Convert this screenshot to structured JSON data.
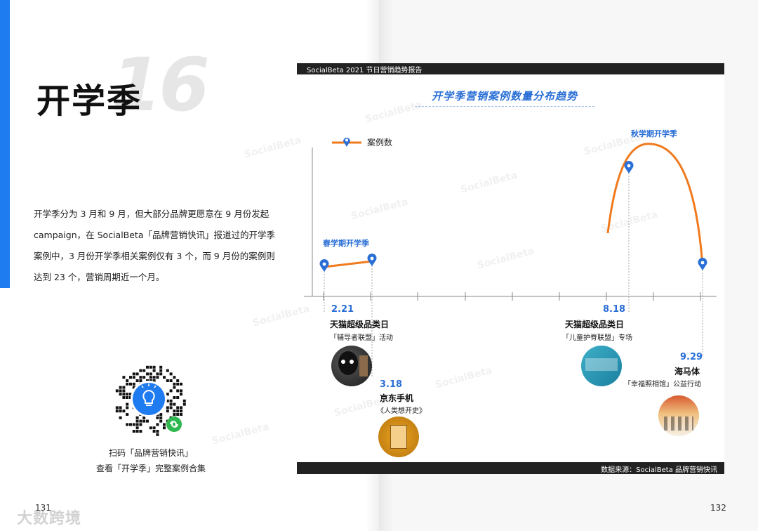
{
  "left_page": {
    "big_number": "16",
    "title": "开学季",
    "paragraph": "开学季分为 3 月和 9 月，但大部分品牌更愿意在 9 月份发起 campaign，在 SocialBeta「品牌营销快讯」报道过的开学季案例中，3 月份开学季相关案例仅有 3 个，而 9 月份的案例则达到 23 个，营销周期近一个月。",
    "qr_caption_line1": "扫码「品牌营销快讯」",
    "qr_caption_line2": "查看「开学季」完整案例合集",
    "page_number": "131",
    "logo_text": "大数跨境"
  },
  "right_page": {
    "page_number": "132",
    "header": "SocialBeta 2021 节日营销趋势报告",
    "footer": "数据来源：SocialBeta 品牌营销快讯",
    "chart_title": "开学季营销案例数量分布趋势",
    "legend_label": "案例数",
    "watermark": "SocialBeta",
    "spring_label": "春学期开学季",
    "autumn_label": "秋学期开学季",
    "events": [
      {
        "date": "2.21",
        "name": "天猫超级品类日",
        "desc": "「辅导者联盟」活动"
      },
      {
        "date": "3.18",
        "name": "京东手机",
        "desc": "《人类想开史》"
      },
      {
        "date": "8.18",
        "name": "天猫超级品类日",
        "desc": "「儿童护脊联盟」专场"
      },
      {
        "date": "9.29",
        "name": "海马体",
        "desc": "「幸福照相馆」公益行动"
      }
    ]
  },
  "colors": {
    "accent_blue": "#1f7bf0",
    "line_orange": "#f07a1e",
    "label_blue": "#2a6fd6"
  },
  "chart_data": {
    "type": "line",
    "title": "开学季营销案例数量分布趋势",
    "series": [
      {
        "name": "案例数",
        "points": [
          {
            "x": "2.21"
          },
          {
            "x": "3.18"
          },
          {
            "x": "8.18"
          },
          {
            "x": "9.29"
          }
        ]
      }
    ],
    "annotations": [
      "春学期开学季",
      "秋学期开学季"
    ],
    "grid": false,
    "legend": "top-left"
  }
}
